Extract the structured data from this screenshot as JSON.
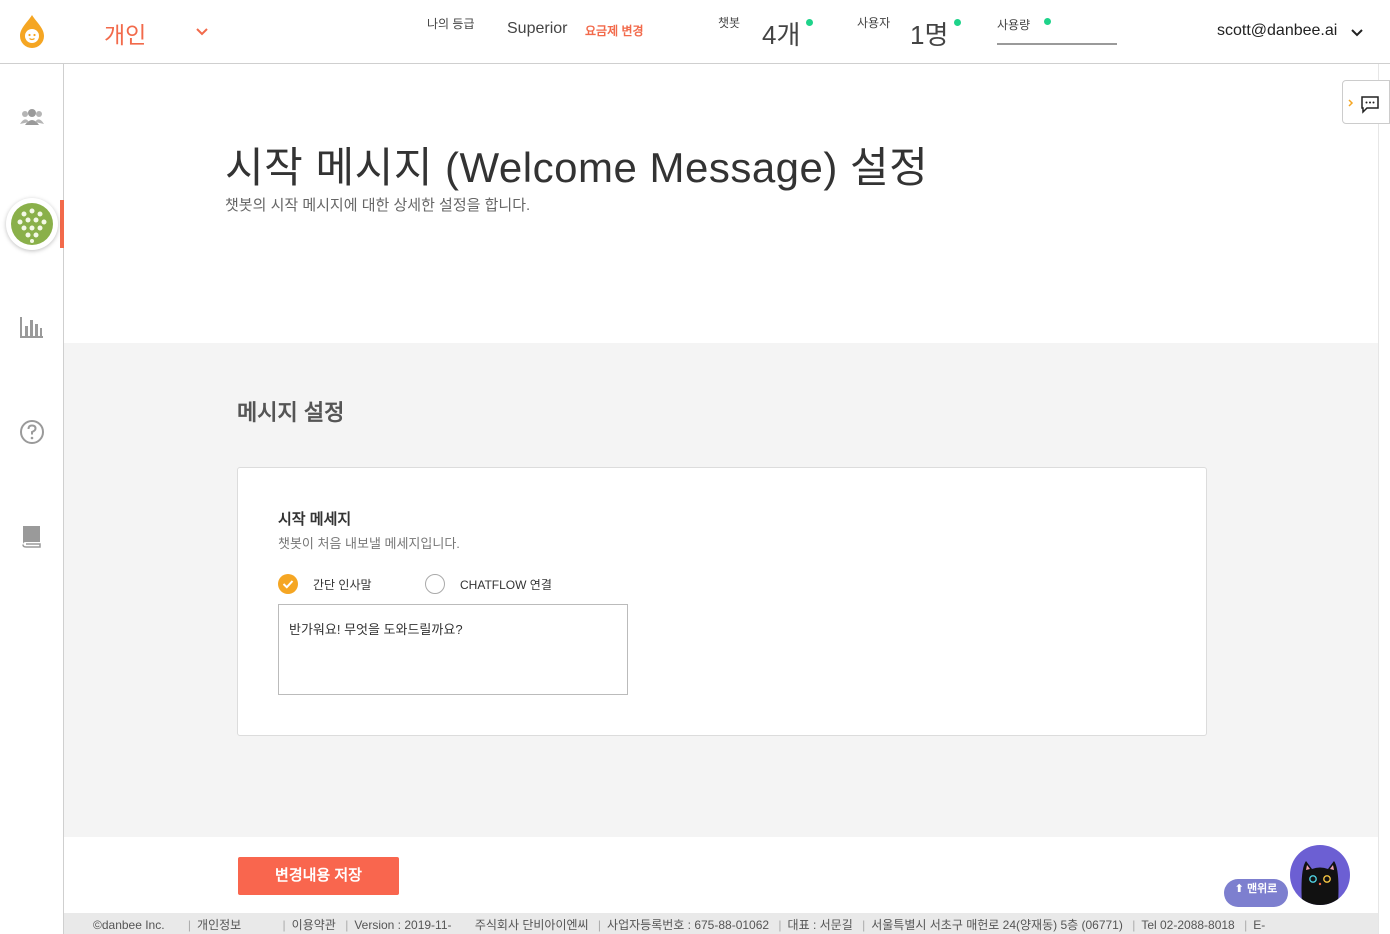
{
  "header": {
    "workspace_name": "개인",
    "grade_label": "나의 등급",
    "grade_value": "Superior",
    "plan_change": "요금제 변경",
    "chatbot_label": "챗봇",
    "chatbot_count": "4개",
    "user_label": "사용자",
    "user_count": "1명",
    "usage_label": "사용량",
    "account": "scott@danbee.ai"
  },
  "sidebar": {
    "items": [
      "users-icon",
      "bot-avatar",
      "chart-icon",
      "help-icon",
      "book-icon"
    ]
  },
  "page": {
    "title": "시작 메시지 (Welcome Message) 설정",
    "subtitle": "챗봇의 시작 메시지에 대한 상세한 설정을 합니다."
  },
  "section": {
    "title": "메시지 설정",
    "card_title": "시작 메세지",
    "card_sub": "챗봇이 처음 내보낼 메세지입니다.",
    "option_simple": "간단 인사말",
    "option_chatflow": "CHATFLOW 연결",
    "selected_option": "간단 인사말",
    "message_value": "반가워요! 무엇을 도와드릴까요?"
  },
  "actions": {
    "save_label": "변경내용 저장"
  },
  "widgets": {
    "to_top_label": "⬆ 맨위로"
  },
  "footer": {
    "copyright": "©danbee Inc.",
    "privacy": "개인정보",
    "terms": "이용약관",
    "version": "Version : 2019-11-",
    "company": "주식회사 단비아이엔씨",
    "biz_no": "사업자등록번호 : 675-88-01062",
    "ceo": "대표 : 서문길",
    "address": "서울특별시 서초구 매헌로 24(양재동) 5층 (06771)",
    "tel": "Tel 02-2088-8018",
    "email_prefix": "E-"
  },
  "colors": {
    "accent": "#f26a4b",
    "radio_checked": "#f5a623",
    "status_dot": "#1ed38a",
    "section_bg": "#f4f4f4"
  }
}
